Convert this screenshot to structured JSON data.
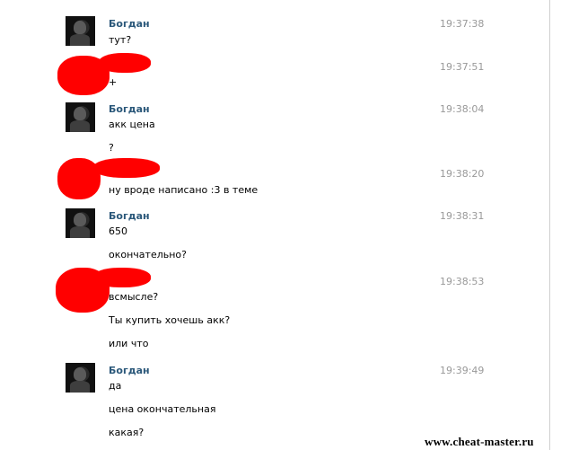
{
  "messages": [
    {
      "author": "Богдан",
      "time": "19:37:38",
      "lines": [
        "тут?"
      ]
    },
    {
      "author": "",
      "time": "19:37:51",
      "lines": [
        "+"
      ]
    },
    {
      "author": "Богдан",
      "time": "19:38:04",
      "lines": [
        "акк цена",
        "?"
      ]
    },
    {
      "author": "",
      "time": "19:38:20",
      "lines": [
        "ну вроде написано :3 в теме"
      ]
    },
    {
      "author": "Богдан",
      "time": "19:38:31",
      "lines": [
        "650",
        "окончательно?"
      ]
    },
    {
      "author": "",
      "time": "19:38:53",
      "lines": [
        "всмысле?",
        "Ты купить хочешь акк?",
        "или что"
      ]
    },
    {
      "author": "Богдан",
      "time": "19:39:49",
      "lines": [
        "да",
        "цена окончательная",
        "какая?"
      ]
    }
  ],
  "watermark": "www.cheat-master.ru",
  "colors": {
    "author": "#2b587a",
    "time": "#999999",
    "redaction": "#ff0000"
  }
}
